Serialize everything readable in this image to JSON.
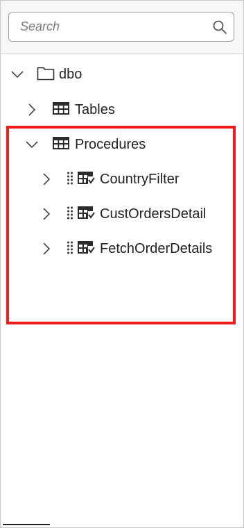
{
  "search": {
    "placeholder": "Search"
  },
  "tree": {
    "root": {
      "label": "dbo",
      "icon": "folder-icon",
      "expanded": true
    },
    "tables": {
      "label": "Tables",
      "icon": "table-icon",
      "expanded": false
    },
    "procedures": {
      "label": "Procedures",
      "icon": "table-icon",
      "expanded": true
    },
    "items": [
      {
        "label": "CountryFilter",
        "icon": "stored-procedure-icon"
      },
      {
        "label": "CustOrdersDetail",
        "icon": "stored-procedure-icon"
      },
      {
        "label": "FetchOrderDetails",
        "icon": "stored-procedure-icon"
      }
    ]
  },
  "colors": {
    "highlight": "#ee1c1c",
    "text": "#222222",
    "icon": "#2b2b2b"
  }
}
